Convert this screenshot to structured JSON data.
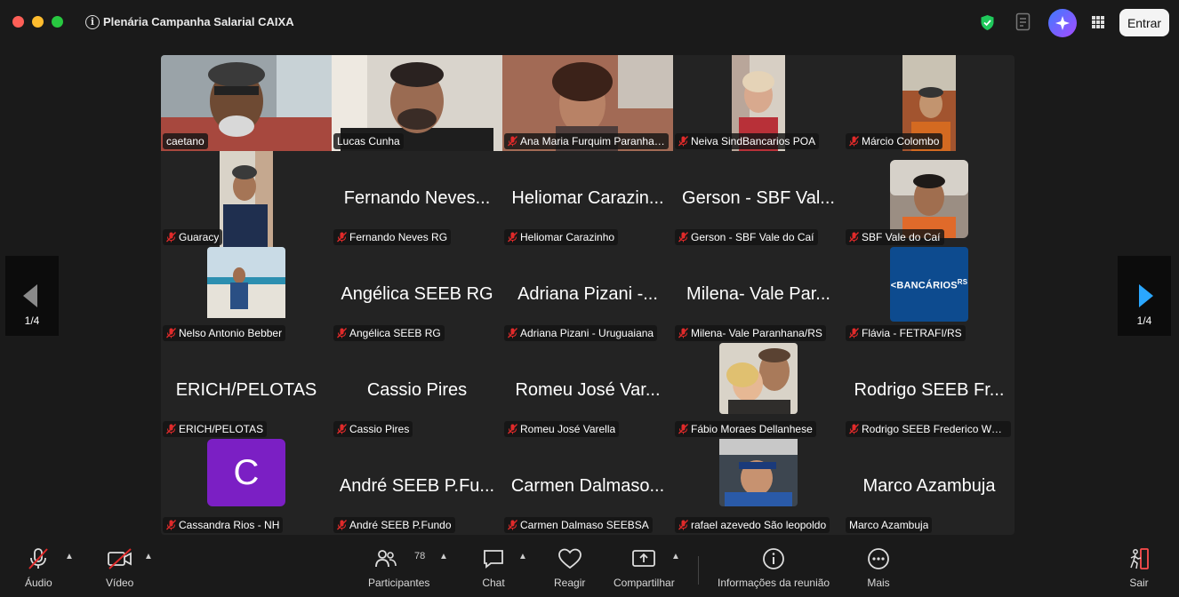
{
  "window": {
    "title": "Plenária Campanha Salarial CAIXA",
    "join_label": "Entrar"
  },
  "pager": {
    "left_label": "1/4",
    "right_label": "1/4"
  },
  "participants": [
    {
      "label": "caetano",
      "muted": false,
      "active": false
    },
    {
      "label": "Lucas Cunha",
      "muted": false,
      "active": true
    },
    {
      "label": "Ana Maria Furquim Paranha…",
      "muted": true,
      "active": false
    },
    {
      "label": "Neiva SindBancarios POA",
      "muted": true,
      "active": false
    },
    {
      "label": "Márcio Colombo",
      "muted": true,
      "active": false
    },
    {
      "label": "Guaracy",
      "muted": true,
      "active": false
    },
    {
      "label": "Fernando Neves RG",
      "display": "Fernando Neves...",
      "muted": true,
      "active": false
    },
    {
      "label": "Heliomar Carazinho",
      "display": "Heliomar Carazin...",
      "muted": true,
      "active": false
    },
    {
      "label": "Gerson - SBF Vale do Caí",
      "display": "Gerson - SBF Val...",
      "muted": true,
      "active": false
    },
    {
      "label": "SBF Vale do Caí",
      "muted": true,
      "active": false
    },
    {
      "label": "Nelso Antonio Bebber",
      "muted": true,
      "active": false
    },
    {
      "label": "Angélica SEEB RG",
      "display": "Angélica SEEB RG",
      "muted": true,
      "active": false
    },
    {
      "label": "Adriana Pizani - Uruguaiana",
      "display": "Adriana Pizani -...",
      "muted": true,
      "active": false
    },
    {
      "label": "Milena- Vale Paranhana/RS",
      "display": "Milena- Vale Par...",
      "muted": true,
      "active": false
    },
    {
      "label": "Flávia - FETRAFI/RS",
      "muted": true,
      "active": false,
      "logo_text": "BANCÁRIOS",
      "logo_suffix": "RS"
    },
    {
      "label": "ERICH/PELOTAS",
      "display": "ERICH/PELOTAS",
      "muted": true,
      "active": false
    },
    {
      "label": "Cassio Pires",
      "display": "Cassio Pires",
      "muted": true,
      "active": false
    },
    {
      "label": "Romeu José Varella",
      "display": "Romeu José Var...",
      "muted": true,
      "active": false
    },
    {
      "label": "Fábio Moraes Dellanhese",
      "muted": true,
      "active": false
    },
    {
      "label": "Rodrigo SEEB Frederico We…",
      "display": "Rodrigo SEEB Fr...",
      "muted": true,
      "active": false
    },
    {
      "label": "Cassandra Rios - NH",
      "muted": true,
      "active": false,
      "avatar_letter": "C"
    },
    {
      "label": "André SEEB P.Fundo",
      "display": "André SEEB P.Fu...",
      "muted": true,
      "active": false
    },
    {
      "label": "Carmen Dalmaso SEEBSA",
      "display": "Carmen Dalmaso...",
      "muted": true,
      "active": false
    },
    {
      "label": "rafael azevedo São leopoldo",
      "muted": true,
      "active": false
    },
    {
      "label": "Marco Azambuja",
      "display": "Marco Azambuja",
      "muted": true,
      "active": false
    }
  ],
  "toolbar": {
    "audio_label": "Áudio",
    "video_label": "Vídeo",
    "participants_label": "Participantes",
    "participants_count": "78",
    "chat_label": "Chat",
    "react_label": "Reagir",
    "share_label": "Compartilhar",
    "info_label": "Informações da reunião",
    "more_label": "Mais",
    "leave_label": "Sair"
  },
  "colors": {
    "active_speaker": "#24d04f",
    "muted_red": "#e02a2a",
    "avatar_purple": "#7b1fc4",
    "logo_blue": "#0d4b8f"
  }
}
